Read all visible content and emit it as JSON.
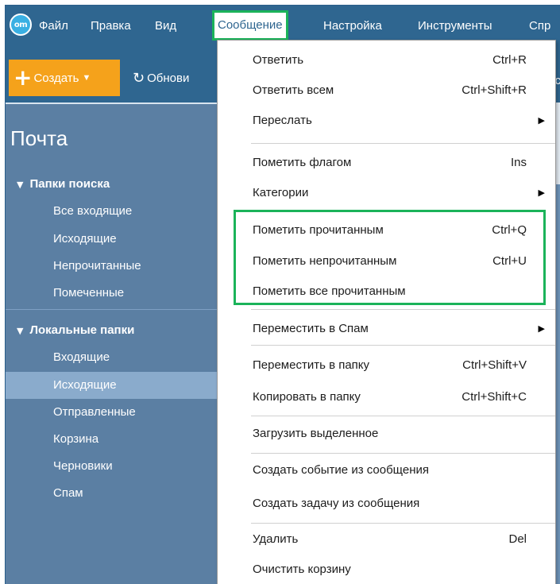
{
  "app": {
    "logo_text": "om"
  },
  "menubar": {
    "items": [
      "Файл",
      "Правка",
      "Вид",
      "Сообщение",
      "Настройка",
      "Инструменты",
      "Спр"
    ],
    "active_index": 3
  },
  "toolbar": {
    "create_label": "Создать",
    "refresh_label": "Обнови",
    "edge_text": "с"
  },
  "sidebar": {
    "title": "Почта",
    "search_folders": {
      "label": "Папки поиска",
      "items": [
        "Все входящие",
        "Исходящие",
        "Непрочитанные",
        "Помеченные"
      ]
    },
    "local_folders": {
      "label": "Локальные папки",
      "items": [
        "Входящие",
        "Исходящие",
        "Отправленные",
        "Корзина",
        "Черновики",
        "Спам"
      ],
      "selected_index": 1
    }
  },
  "dropdown": {
    "items": [
      {
        "label": "Ответить",
        "shortcut": "Ctrl+R"
      },
      {
        "label": "Ответить всем",
        "shortcut": "Ctrl+Shift+R"
      },
      {
        "label": "Переслать",
        "shortcut": "",
        "submenu": true
      },
      {
        "label": "Пометить флагом",
        "shortcut": "Ins"
      },
      {
        "label": "Категории",
        "shortcut": "",
        "submenu": true
      },
      {
        "label": "Пометить прочитанным",
        "shortcut": "Ctrl+Q"
      },
      {
        "label": "Пометить непрочитанным",
        "shortcut": "Ctrl+U"
      },
      {
        "label": "Пометить все прочитанным",
        "shortcut": ""
      },
      {
        "label": "Переместить в Спам",
        "shortcut": "",
        "submenu": true
      },
      {
        "label": "Переместить в папку",
        "shortcut": "Ctrl+Shift+V"
      },
      {
        "label": "Копировать в папку",
        "shortcut": "Ctrl+Shift+C"
      },
      {
        "label": "Загрузить выделенное",
        "shortcut": ""
      },
      {
        "label": "Создать событие из сообщения",
        "shortcut": ""
      },
      {
        "label": "Создать задачу из сообщения",
        "shortcut": ""
      },
      {
        "label": "Удалить",
        "shortcut": "Del"
      },
      {
        "label": "Очистить корзину",
        "shortcut": ""
      }
    ]
  },
  "colors": {
    "menubar_bg": "#2f6690",
    "sidebar_bg": "#5b7fa3",
    "create_button": "#f5a21b",
    "highlight": "#1bb35a",
    "selected_folder": "#8aabcc"
  }
}
